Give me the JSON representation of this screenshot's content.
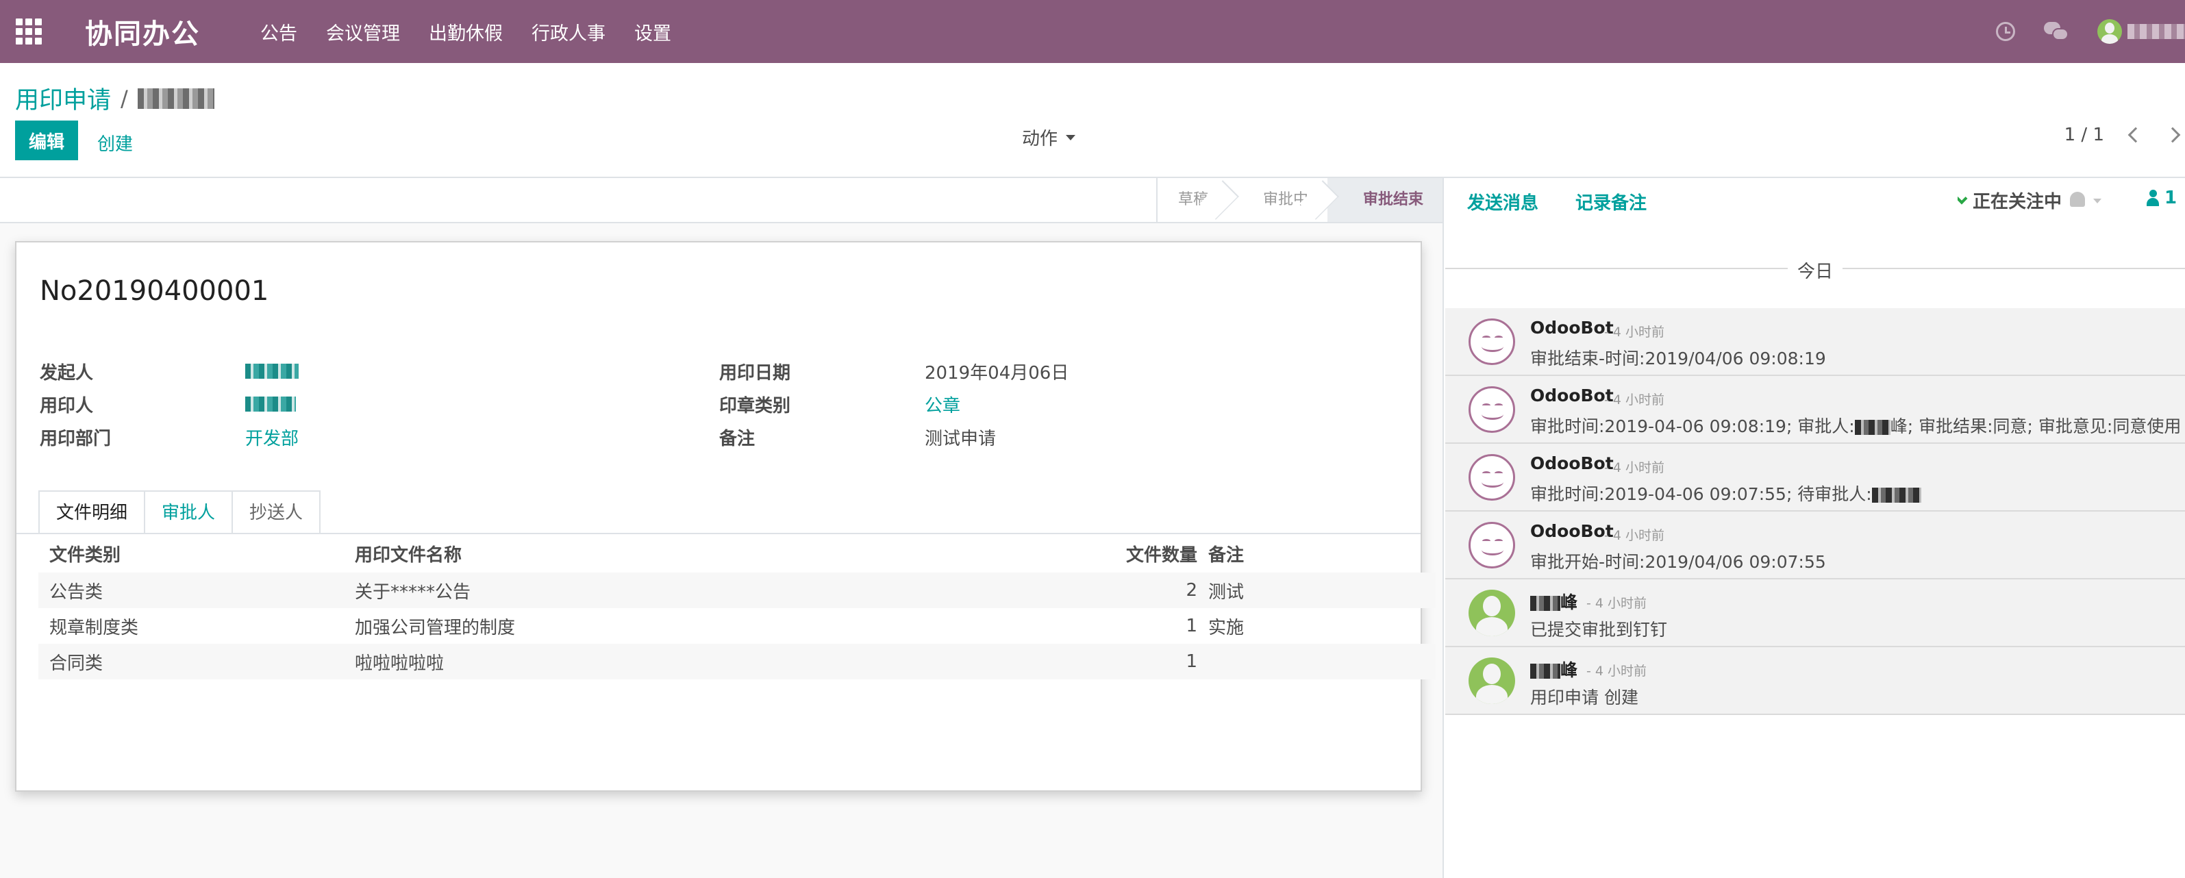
{
  "navbar": {
    "brand": "协同办公",
    "menu": [
      "公告",
      "会议管理",
      "出勤休假",
      "行政人事",
      "设置"
    ],
    "colors": {
      "bar": "#875a7b",
      "accent": "#00a09d"
    }
  },
  "control_panel": {
    "breadcrumb_root": "用印申请",
    "breadcrumb_sep": "/",
    "edit_label": "编辑",
    "create_label": "创建",
    "action_label": "动作",
    "pager_value": "1 / 1"
  },
  "statusbar": {
    "steps": [
      "草稿",
      "审批中",
      "审批结束"
    ],
    "active": "审批结束"
  },
  "form": {
    "record_name": "No20190400001",
    "fields_left": [
      {
        "label": "发起人"
      },
      {
        "label": "用印人"
      },
      {
        "label": "用印部门",
        "value": "开发部"
      }
    ],
    "fields_right": [
      {
        "label": "用印日期",
        "value": "2019年04月06日"
      },
      {
        "label": "印章类别",
        "value": "公章"
      },
      {
        "label": "备注",
        "value": "测试申请"
      }
    ],
    "tabs": [
      "文件明细",
      "审批人",
      "抄送人"
    ],
    "table": {
      "headers": [
        "文件类别",
        "用印文件名称",
        "文件数量",
        "备注"
      ],
      "rows": [
        [
          "公告类",
          "关于*****公告",
          "2",
          "测试"
        ],
        [
          "规章制度类",
          "加强公司管理的制度",
          "1",
          "实施"
        ],
        [
          "合同类",
          "啦啦啦啦啦",
          "1",
          ""
        ]
      ]
    }
  },
  "chatter": {
    "send_message": "发送消息",
    "log_note": "记录备注",
    "following": "正在关注中",
    "followers_count": "1",
    "date_separator": "今日",
    "messages": [
      {
        "author": "OdooBot",
        "time": "- 4 小时前",
        "body": "审批结束-时间:2019/04/06 09:08:19",
        "avatar": "bot"
      },
      {
        "author": "OdooBot",
        "time": "- 4 小时前",
        "body_pre": "审批时间:2019-04-06 09:08:19; 审批人:",
        "body_post": "峰; 审批结果:同意; 审批意见:同意使用",
        "avatar": "bot"
      },
      {
        "author": "OdooBot",
        "time": "- 4 小时前",
        "body_pre": "审批时间:2019-04-06 09:07:55; 待审批人:",
        "body_post": "",
        "avatar": "bot"
      },
      {
        "author": "OdooBot",
        "time": "- 4 小时前",
        "body": "审批开始-时间:2019/04/06 09:07:55",
        "avatar": "bot"
      },
      {
        "author_suffix": "峰",
        "time": "- 4 小时前",
        "body": "已提交审批到钉钉",
        "avatar": "human"
      },
      {
        "author_suffix": "峰",
        "time": "- 4 小时前",
        "body": "用印申请 创建",
        "avatar": "human"
      }
    ]
  }
}
